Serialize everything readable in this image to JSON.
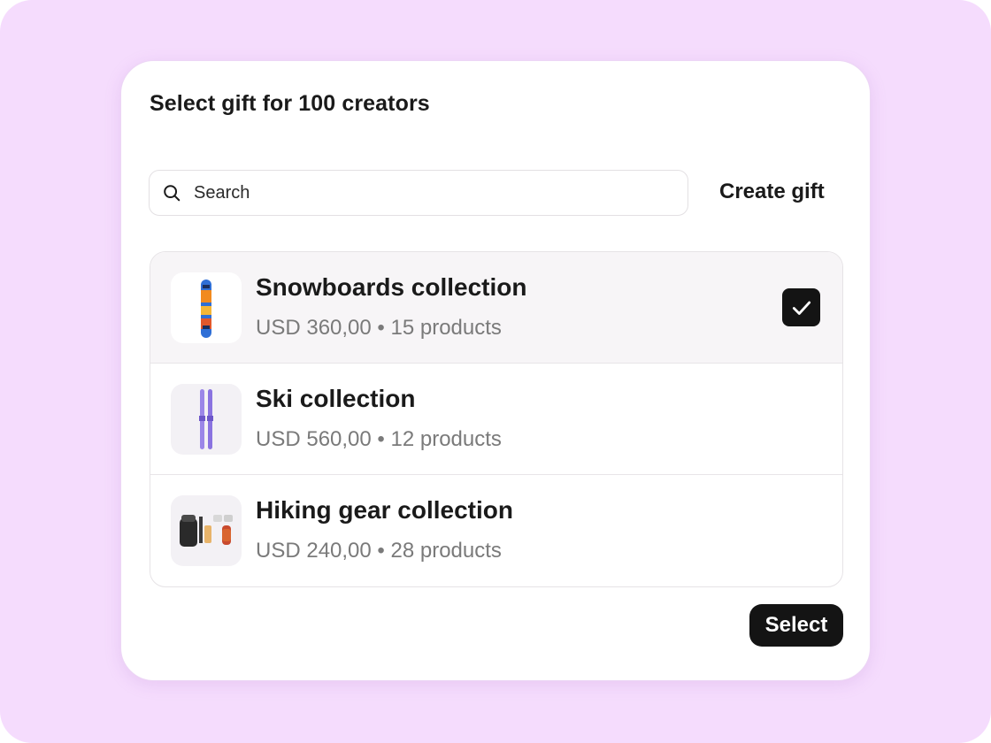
{
  "dialog": {
    "title": "Select gift for 100 creators",
    "search": {
      "placeholder": "Search",
      "value": ""
    },
    "create_label": "Create gift",
    "select_label": "Select"
  },
  "gifts": [
    {
      "name": "Snowboards collection",
      "meta": "USD 360,00 • 15 products",
      "selected": true,
      "icon": "snowboard-image"
    },
    {
      "name": "Ski collection",
      "meta": "USD 560,00 • 12 products",
      "selected": false,
      "icon": "ski-image"
    },
    {
      "name": "Hiking gear collection",
      "meta": "USD 240,00 • 28 products",
      "selected": false,
      "icon": "hiking-gear-image"
    }
  ],
  "colors": {
    "background": "#f5dcfd",
    "accent": "#141414",
    "muted_text": "#7a7a7a"
  }
}
